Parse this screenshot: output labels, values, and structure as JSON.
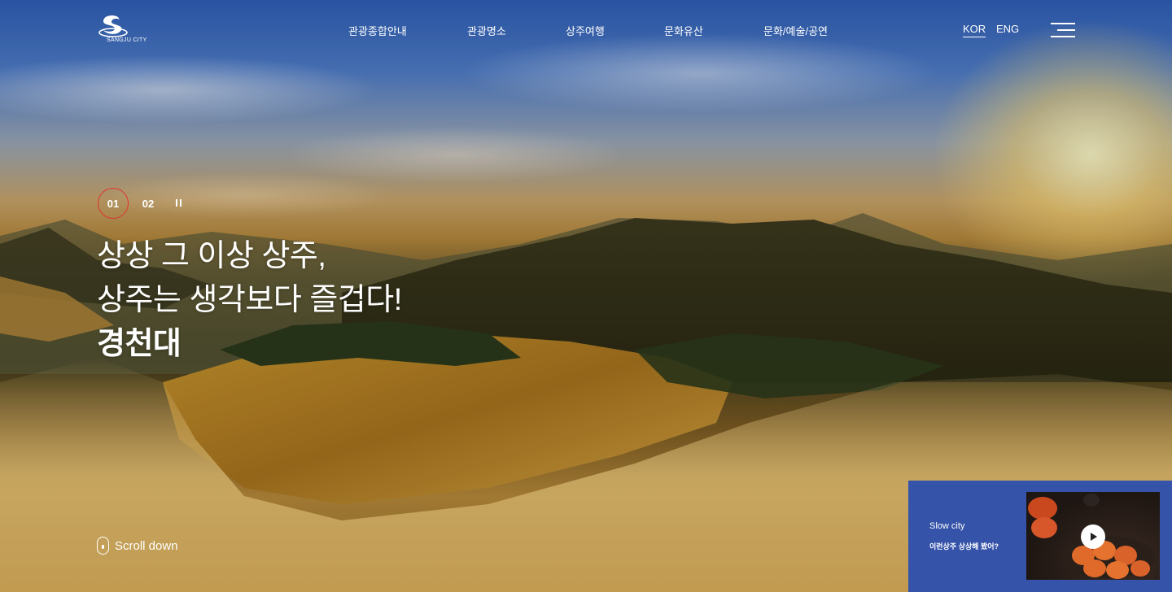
{
  "header": {
    "logo_text": "SANGJU CITY",
    "nav": [
      "관광종합안내",
      "관광명소",
      "상주여행",
      "문화유산",
      "문화/예술/공연"
    ],
    "languages": [
      {
        "label": "KOR",
        "active": true
      },
      {
        "label": "ENG",
        "active": false
      }
    ],
    "menu_icon": "hamburger-menu-icon"
  },
  "slider": {
    "numbers": [
      "01",
      "02"
    ],
    "active_index": 0,
    "active_color": "#e0332e",
    "pause_icon": "pause-icon"
  },
  "hero": {
    "line1": "상상 그 이상 상주,",
    "line2": "상주는 생각보다 즐겁다!",
    "place": "경천대"
  },
  "scroll": {
    "label": "Scroll down",
    "icon": "mouse-icon"
  },
  "promo": {
    "label": "Slow city",
    "title": "이런상주 상상해 봤어?",
    "background": "#3553a8",
    "play_icon": "play-icon"
  }
}
